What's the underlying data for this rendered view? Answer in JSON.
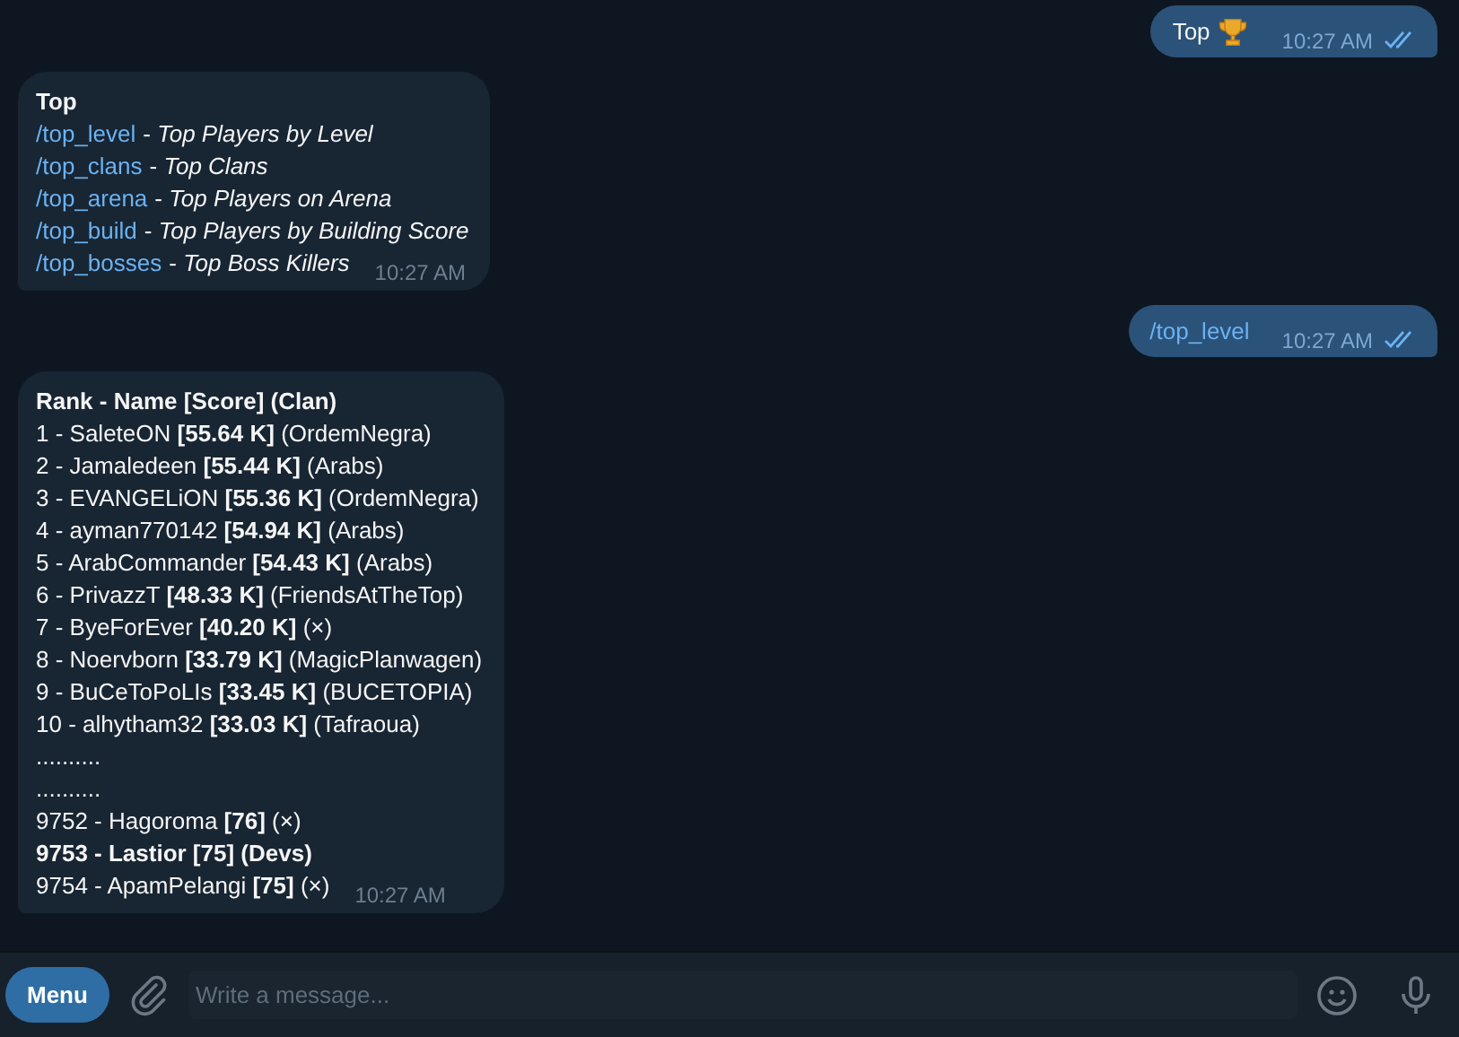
{
  "messages": [
    {
      "kind": "outgoing",
      "text": "Top",
      "link": false,
      "trophy": true,
      "time": "10:27 AM",
      "read": true
    },
    {
      "kind": "menu",
      "title": "Top",
      "lines": [
        {
          "command": "/top_level",
          "description": "- *Top Players by Level*"
        },
        {
          "command": "/top_clans",
          "description": "- *Top Clans*"
        },
        {
          "command": "/top_arena",
          "description": "- *Top Players on Arena*"
        },
        {
          "command": "/top_build",
          "description": "- *Top Players by Building Score*"
        },
        {
          "command": "/top_bosses",
          "description": "- *Top Boss Killers*"
        }
      ],
      "time": "10:27 AM"
    },
    {
      "kind": "outgoing",
      "text": "/top_level",
      "link": true,
      "time": "10:27 AM",
      "read": true
    },
    {
      "kind": "ranking",
      "header": "Rank - Name [Score] (Clan)",
      "lines": [
        {
          "text": "1 - SaleteON **[55.64 K]**  (OrdemNegra)",
          "bold": false
        },
        {
          "text": "2 - Jamaledeen **[55.44 K]**  (Arabs)",
          "bold": false
        },
        {
          "text": "3 - EVANGELiON **[55.36 K]**  (OrdemNegra)",
          "bold": false
        },
        {
          "text": "4 - ayman770142 **[54.94 K]**  (Arabs)",
          "bold": false
        },
        {
          "text": "5 - ArabCommander **[54.43 K]**  (Arabs)",
          "bold": false
        },
        {
          "text": "6 - PrivazzT **[48.33 K]**  (FriendsAtTheTop)",
          "bold": false
        },
        {
          "text": "7 - ByeForEver **[40.20 K]**  (×)",
          "bold": false
        },
        {
          "text": "8 - Noervborn **[33.79 K]**  (MagicPlanwagen)",
          "bold": false
        },
        {
          "text": "9 - BuCeToPoLIs **[33.45 K]**  (BUCETOPIA)",
          "bold": false
        },
        {
          "text": "10 - alhytham32 **[33.03 K]**  (Tafraoua)",
          "bold": false
        },
        {
          "text": "..........",
          "bold": false
        },
        {
          "text": "..........",
          "bold": false
        },
        {
          "text": "9752 - Hagoroma **[76]**  (×)",
          "bold": false
        },
        {
          "text": "9753 - Lastior [75]  (Devs)",
          "bold": true
        },
        {
          "text": "9754 - ApamPelangi **[75]**  (×)",
          "bold": false
        }
      ],
      "time": "10:27 AM"
    }
  ],
  "composer": {
    "menu_button": "Menu",
    "placeholder": "Write a message..."
  }
}
